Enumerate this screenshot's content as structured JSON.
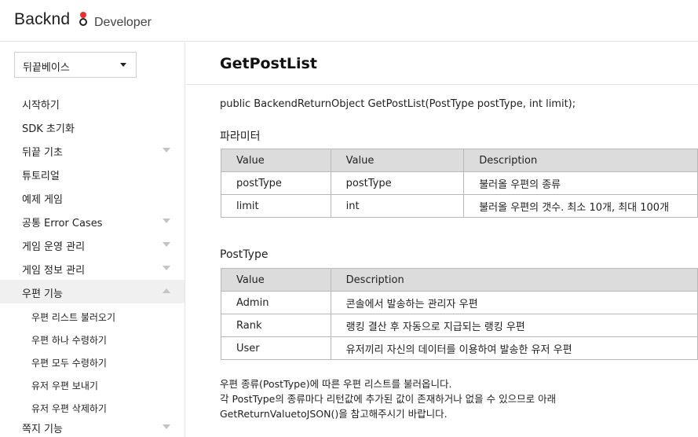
{
  "header": {
    "logo_text": "Backnd",
    "sub_title": "Developer"
  },
  "sidebar": {
    "select_value": "뒤끝베이스",
    "items": [
      {
        "label": "시작하기",
        "arrow": "none"
      },
      {
        "label": "SDK 초기화",
        "arrow": "none"
      },
      {
        "label": "뒤끝 기초",
        "arrow": "down"
      },
      {
        "label": "튜토리얼",
        "arrow": "none"
      },
      {
        "label": "예제 게임",
        "arrow": "none"
      },
      {
        "label": "공통 Error Cases",
        "arrow": "down"
      },
      {
        "label": "게임 운영 관리",
        "arrow": "down"
      },
      {
        "label": "게임 정보 관리",
        "arrow": "down"
      },
      {
        "label": "우편 기능",
        "arrow": "up"
      }
    ],
    "sub_items": [
      {
        "label": "우편 리스트 불러오기"
      },
      {
        "label": "우편 하나 수령하기"
      },
      {
        "label": "우편 모두 수령하기"
      },
      {
        "label": "유저 우편 보내기"
      },
      {
        "label": "유저 우편 삭제하기"
      }
    ],
    "last_item": {
      "label": "쪽지 기능",
      "arrow": "down"
    }
  },
  "main": {
    "title": "GetPostList",
    "signature": "public BackendReturnObject GetPostList(PostType postType, int limit);",
    "params_heading": "파라미터",
    "params_headers": [
      "Value",
      "Value",
      "Description"
    ],
    "params_rows": [
      [
        "postType",
        "postType",
        "불러올 우편의 종류"
      ],
      [
        "limit",
        "int",
        "불러올 우편의 갯수. 최소 10개, 최대 100개"
      ]
    ],
    "posttype_heading": "PostType",
    "posttype_headers": [
      "Value",
      "Description"
    ],
    "posttype_rows": [
      [
        "Admin",
        "콘솔에서 발송하는 관리자 우편"
      ],
      [
        "Rank",
        "랭킹 결산 후 자동으로 지급되는 랭킹 우편"
      ],
      [
        "User",
        "유저끼리 자신의 데이터를 이용하여 발송한 유저 우편"
      ]
    ],
    "description_lines": [
      "우편 종류(PostType)에 따른 우편 리스트를 불러옵니다.",
      "각 PostType의 종류마다 리턴값에 추가된 값이 존재하거나 없을 수 있으므로 아래",
      "GetReturnValuetoJSON()을 참고해주시기 바랍니다."
    ]
  }
}
